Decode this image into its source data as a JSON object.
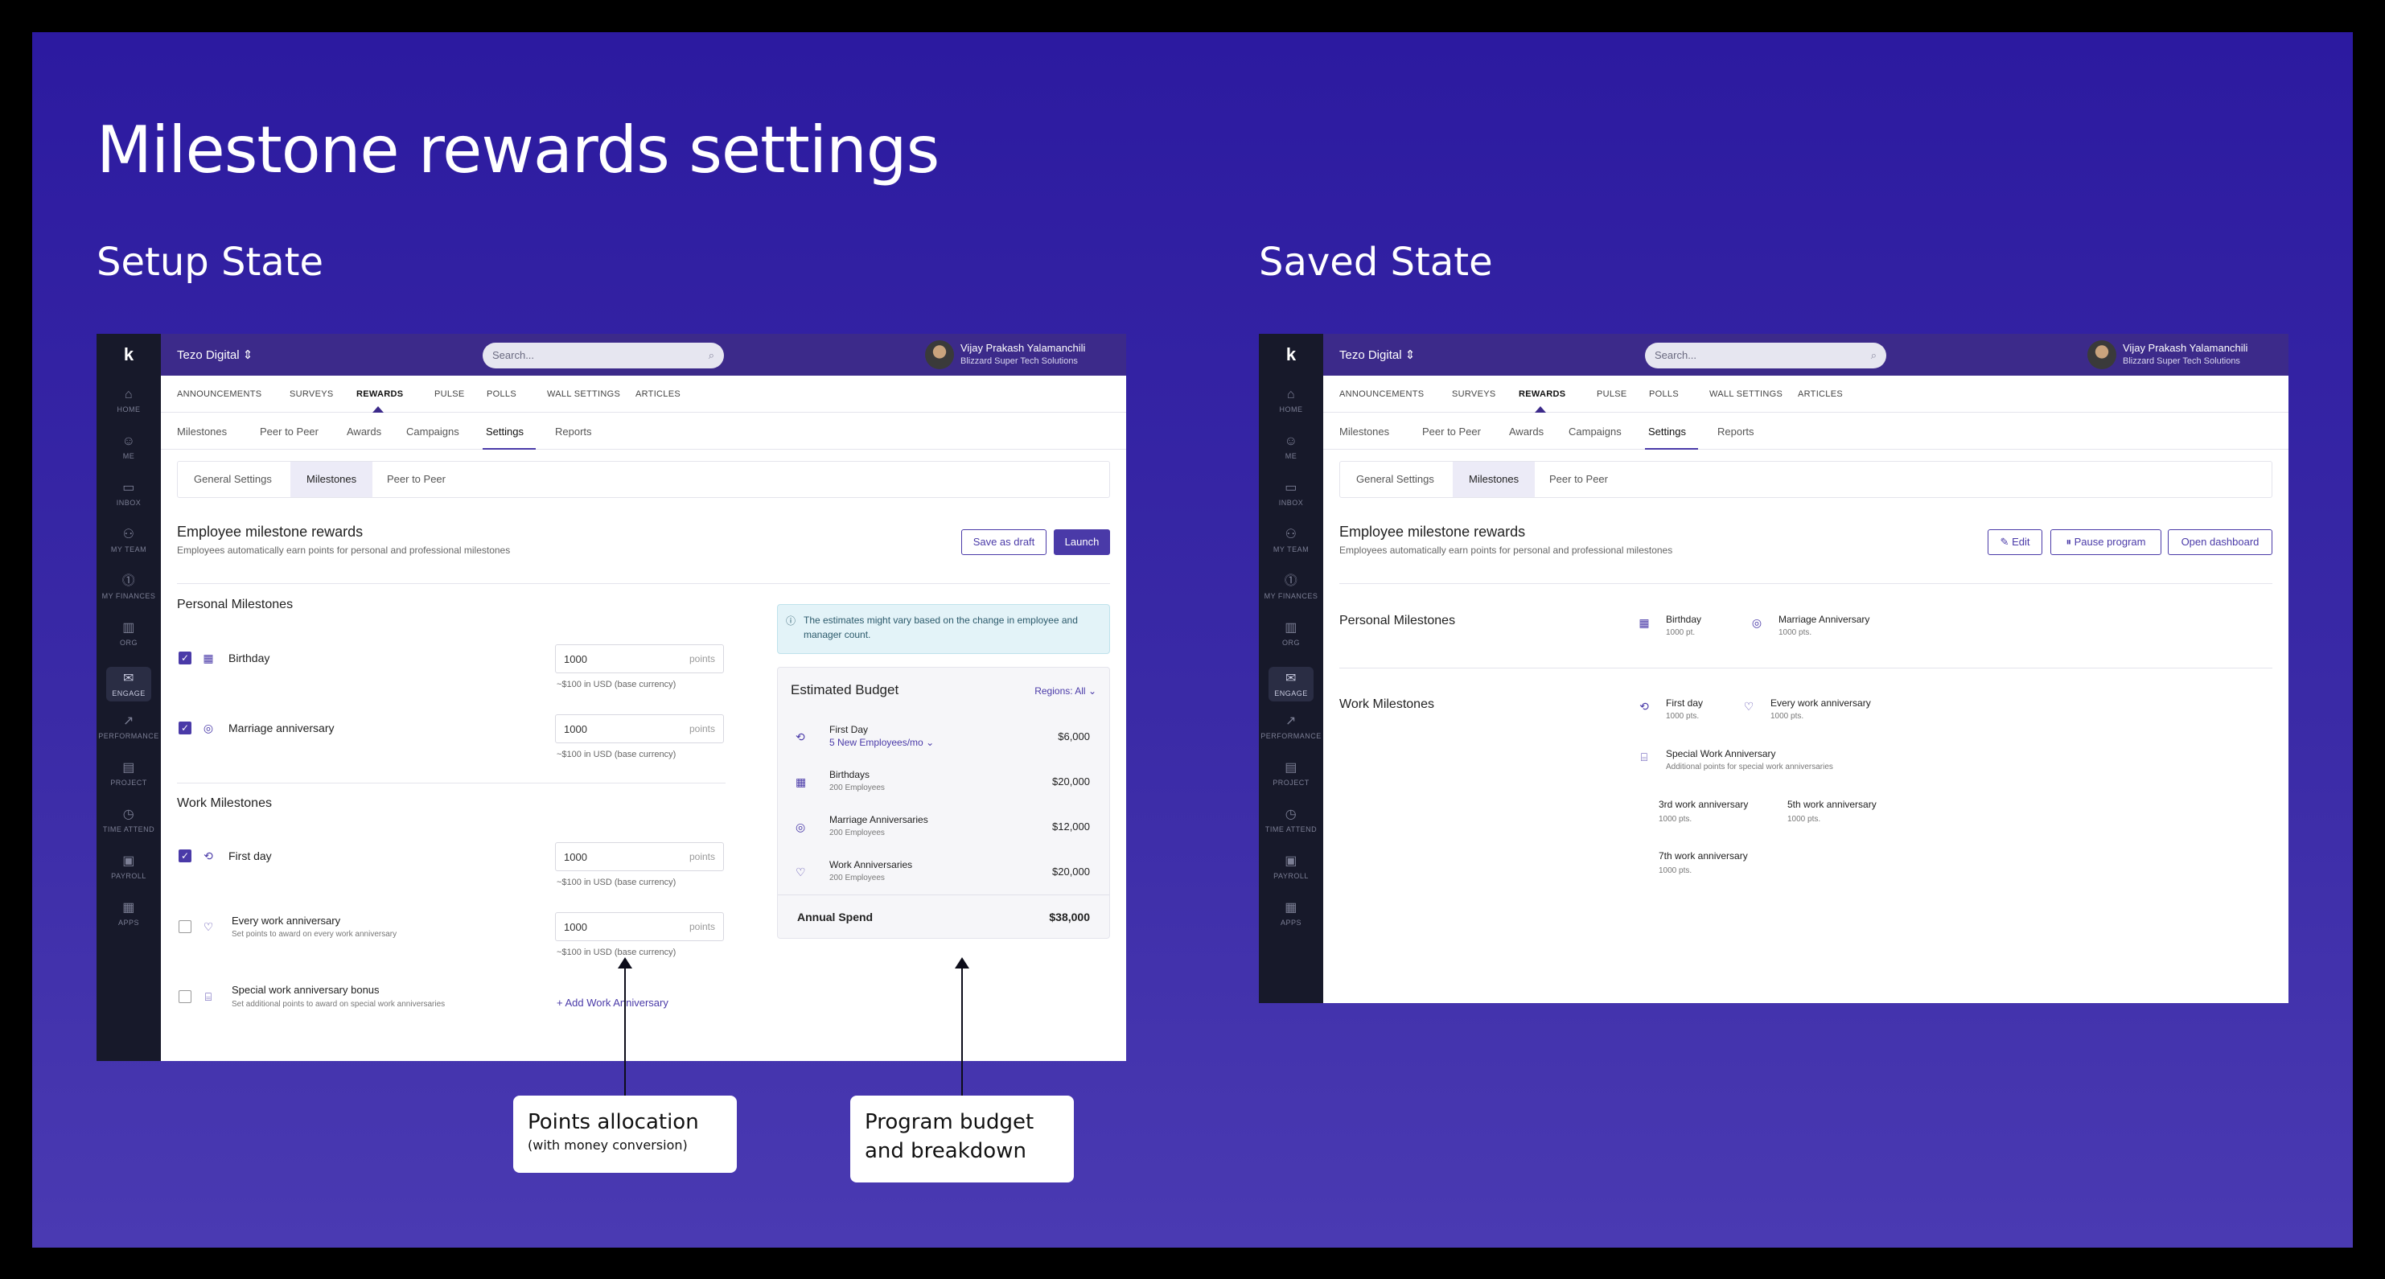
{
  "page_title": "Milestone rewards settings",
  "setup_heading": "Setup State",
  "saved_heading": "Saved State",
  "app": {
    "logo": "k",
    "org_name": "Tezo Digital",
    "search_placeholder": "Search...",
    "user_name": "Vijay Prakash Yalamanchili",
    "user_company": "Blizzard Super Tech Solutions",
    "nav": [
      {
        "label": "HOME",
        "icon": "home-icon"
      },
      {
        "label": "ME",
        "icon": "person-icon"
      },
      {
        "label": "INBOX",
        "icon": "inbox-icon"
      },
      {
        "label": "MY TEAM",
        "icon": "team-icon"
      },
      {
        "label": "MY FINANCES",
        "icon": "finance-icon"
      },
      {
        "label": "ORG",
        "icon": "org-icon"
      },
      {
        "label": "ENGAGE",
        "icon": "engage-icon"
      },
      {
        "label": "PERFORMANCE",
        "icon": "performance-icon"
      },
      {
        "label": "PROJECT",
        "icon": "project-icon"
      },
      {
        "label": "TIME ATTEND",
        "icon": "clock-icon"
      },
      {
        "label": "PAYROLL",
        "icon": "payroll-icon"
      },
      {
        "label": "APPS",
        "icon": "apps-icon"
      }
    ],
    "top_tabs": [
      "ANNOUNCEMENTS",
      "SURVEYS",
      "REWARDS",
      "PULSE",
      "POLLS",
      "WALL SETTINGS",
      "ARTICLES"
    ],
    "sub_tabs": [
      "Milestones",
      "Peer to Peer",
      "Awards",
      "Campaigns",
      "Settings",
      "Reports"
    ],
    "settings_tabs": [
      "General Settings",
      "Milestones",
      "Peer to Peer"
    ],
    "panel_title": "Employee milestone rewards",
    "panel_desc": "Employees automatically earn points for personal and professional milestones"
  },
  "setup": {
    "save_draft": "Save as draft",
    "launch": "Launch",
    "personal_heading": "Personal Milestones",
    "work_heading": "Work Milestones",
    "personal": [
      {
        "label": "Birthday",
        "checked": true,
        "value": "1000",
        "unit": "points",
        "conversion": "~$100 in USD (base currency)"
      },
      {
        "label": "Marriage anniversary",
        "checked": true,
        "value": "1000",
        "unit": "points",
        "conversion": "~$100 in USD (base currency)"
      }
    ],
    "work": [
      {
        "label": "First day",
        "checked": true,
        "value": "1000",
        "unit": "points",
        "conversion": "~$100 in USD (base currency)"
      },
      {
        "label": "Every work anniversary",
        "sub": "Set points to award on every work anniversary",
        "checked": false,
        "value": "1000",
        "unit": "points",
        "conversion": "~$100 in USD (base currency)"
      },
      {
        "label": "Special work anniversary bonus",
        "sub": "Set additional points to award on special work anniversaries",
        "checked": false,
        "add_link": "+ Add Work Anniversary"
      }
    ],
    "info_text": "The estimates might vary based on the change in employee and manager count.",
    "budget": {
      "title": "Estimated Budget",
      "regions": "Regions: All",
      "rows": [
        {
          "name": "First Day",
          "sub": "5 New Employees/mo",
          "amount": "$6,000"
        },
        {
          "name": "Birthdays",
          "sub": "200 Employees",
          "amount": "$20,000"
        },
        {
          "name": "Marriage Anniversaries",
          "sub": "200 Employees",
          "amount": "$12,000"
        },
        {
          "name": "Work Anniversaries",
          "sub": "200 Employees",
          "amount": "$20,000"
        }
      ],
      "annual_label": "Annual Spend",
      "annual_value": "$38,000"
    }
  },
  "saved": {
    "edit": "Edit",
    "pause": "Pause program",
    "open_dashboard": "Open dashboard",
    "personal_heading": "Personal Milestones",
    "work_heading": "Work Milestones",
    "personal": [
      {
        "name": "Birthday",
        "points": "1000 pt."
      },
      {
        "name": "Marriage Anniversary",
        "points": "1000 pts."
      }
    ],
    "work": [
      {
        "name": "First day",
        "points": "1000 pts."
      },
      {
        "name": "Every work anniversary",
        "points": "1000 pts."
      }
    ],
    "special": {
      "name": "Special Work Anniversary",
      "desc": "Additional points for special work anniversaries"
    },
    "anniversaries": [
      {
        "name": "3rd work anniversary",
        "points": "1000 pts."
      },
      {
        "name": "5th work anniversary",
        "points": "1000 pts."
      },
      {
        "name": "7th work anniversary",
        "points": "1000 pts."
      }
    ]
  },
  "callouts": {
    "points_title": "Points allocation",
    "points_sub": "(with money conversion)",
    "budget_line1": "Program budget",
    "budget_line2": "and breakdown"
  },
  "colors": {
    "brand": "#4a3aa8",
    "topbar": "#3c2a8a",
    "sidebar": "#17192a",
    "background": "#2c1aa0"
  }
}
